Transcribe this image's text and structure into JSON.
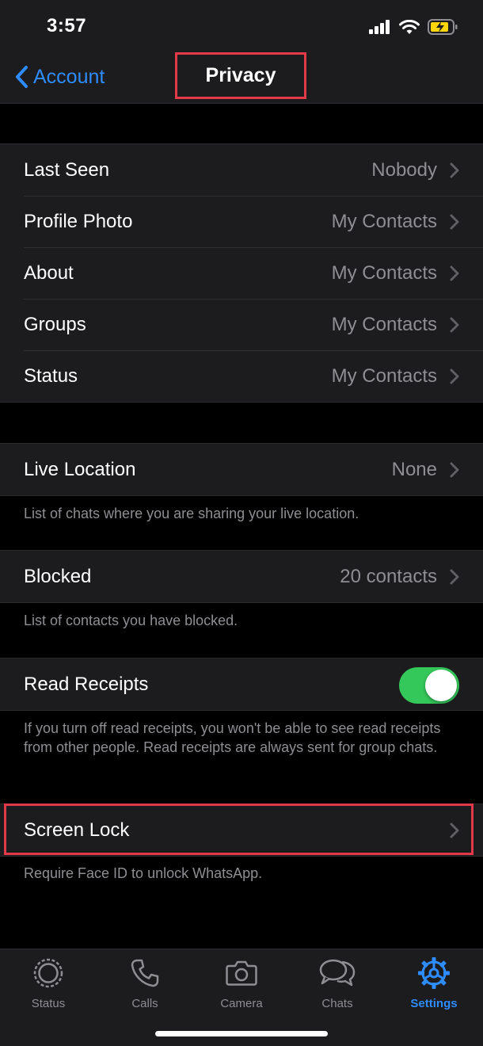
{
  "status_bar": {
    "time": "3:57"
  },
  "nav": {
    "back_label": "Account",
    "title": "Privacy"
  },
  "privacy_group": [
    {
      "label": "Last Seen",
      "value": "Nobody"
    },
    {
      "label": "Profile Photo",
      "value": "My Contacts"
    },
    {
      "label": "About",
      "value": "My Contacts"
    },
    {
      "label": "Groups",
      "value": "My Contacts"
    },
    {
      "label": "Status",
      "value": "My Contacts"
    }
  ],
  "live_location": {
    "label": "Live Location",
    "value": "None",
    "footnote": "List of chats where you are sharing your live location."
  },
  "blocked": {
    "label": "Blocked",
    "value": "20 contacts",
    "footnote": "List of contacts you have blocked."
  },
  "read_receipts": {
    "label": "Read Receipts",
    "enabled": true,
    "footnote": "If you turn off read receipts, you won't be able to see read receipts from other people. Read receipts are always sent for group chats."
  },
  "screen_lock": {
    "label": "Screen Lock",
    "footnote": "Require Face ID to unlock WhatsApp."
  },
  "tabs": [
    {
      "label": "Status",
      "icon": "status-icon",
      "active": false
    },
    {
      "label": "Calls",
      "icon": "phone-icon",
      "active": false
    },
    {
      "label": "Camera",
      "icon": "camera-icon",
      "active": false
    },
    {
      "label": "Chats",
      "icon": "chat-bubbles-icon",
      "active": false
    },
    {
      "label": "Settings",
      "icon": "gear-icon",
      "active": true
    }
  ],
  "colors": {
    "accent": "#2f8cff",
    "toggle_on": "#34c759",
    "highlight": "#e23a48",
    "battery_charging": "#ffd60a"
  }
}
